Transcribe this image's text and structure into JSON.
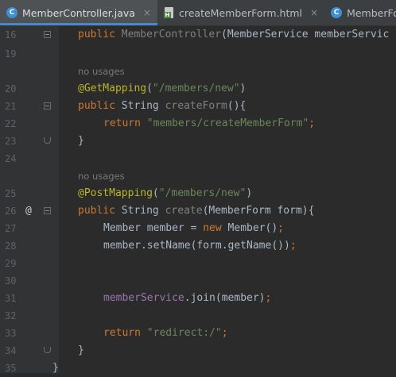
{
  "tabs": [
    {
      "label": "MemberController.java",
      "icon": "c-class-icon",
      "active": true
    },
    {
      "label": "createMemberForm.html",
      "icon": "html-file-icon",
      "active": false
    },
    {
      "label": "MemberForm.java",
      "icon": "c-class-icon",
      "active": false
    }
  ],
  "tab_close_glyph": "×",
  "class_icon_letter": "C",
  "html_icon_letter": "H",
  "gutter_marker": "@",
  "editor": {
    "line_numbers": [
      "16",
      "19",
      "20",
      "21",
      "22",
      "23",
      "24",
      "25",
      "26",
      "27",
      "28",
      "29",
      "30",
      "31",
      "32",
      "33",
      "34",
      "35"
    ],
    "hint_no_usages": "no usages",
    "code": {
      "l16_kw": "public",
      "l16_name": "MemberController",
      "l16_rest": "(MemberService memberServic",
      "l20_ann": "@GetMapping",
      "l20_str": "\"/members/new\"",
      "l21_kw": "public",
      "l21_type": "String",
      "l21_name": "createForm",
      "l21_rest": "(){",
      "l22_kw": "return",
      "l22_str": "\"members/createMemberForm\"",
      "l22_semi": ";",
      "l23_brace": "}",
      "l25_ann": "@PostMapping",
      "l25_str": "\"/members/new\"",
      "l26_kw": "public",
      "l26_type": "String",
      "l26_name": "create",
      "l26_rest": "(MemberForm form){",
      "l27_a": "Member member = ",
      "l27_new": "new",
      "l27_b": " Member()",
      "l27_semi": ";",
      "l28_a": "member.setName(form.getName())",
      "l28_semi": ";",
      "l31_field": "memberService",
      "l31_rest": ".join(member)",
      "l31_semi": ";",
      "l33_kw": "return",
      "l33_str": "\"redirect:/\"",
      "l33_semi": ";",
      "l34_brace": "}",
      "l35_brace": "}"
    }
  }
}
